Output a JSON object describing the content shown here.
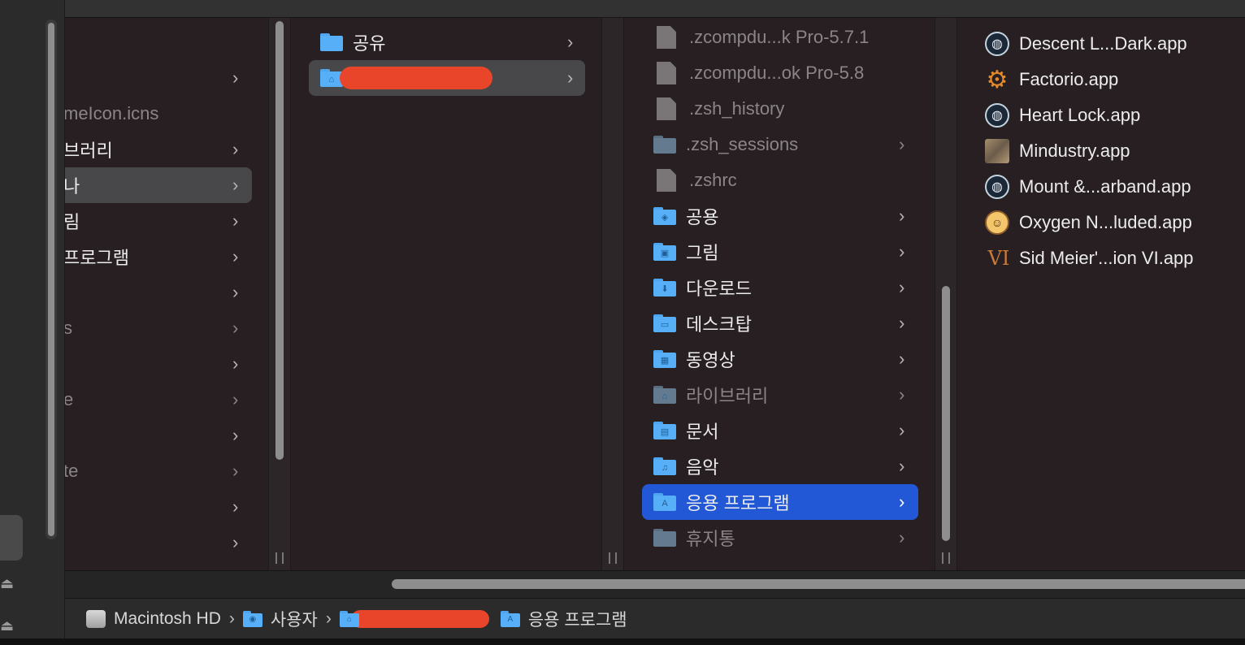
{
  "col1": {
    "items": [
      {
        "label": "",
        "chevron": true
      },
      {
        "label": "meIcon.icns",
        "chevron": false,
        "dim": true
      },
      {
        "label": "브러리",
        "chevron": true
      },
      {
        "label": "나",
        "chevron": true,
        "selected": true
      },
      {
        "label": "림",
        "chevron": true
      },
      {
        "label": "프로그램",
        "chevron": true
      },
      {
        "label": "",
        "chevron": true
      },
      {
        "label": "s",
        "chevron": true,
        "dim": true
      },
      {
        "label": "",
        "chevron": true
      },
      {
        "label": "e",
        "chevron": true,
        "dim": true
      },
      {
        "label": "",
        "chevron": true
      },
      {
        "label": "te",
        "chevron": true,
        "dim": true
      },
      {
        "label": "",
        "chevron": true
      },
      {
        "label": "",
        "chevron": true
      }
    ]
  },
  "col2": {
    "items": [
      {
        "label": "공유",
        "icon": "folder-icon",
        "chevron": true
      },
      {
        "label": "",
        "icon": "home-folder-icon",
        "chevron": true,
        "selected": true,
        "redacted": true
      }
    ]
  },
  "col3": {
    "items": [
      {
        "label": ".zcompdu...k Pro-5.7.1",
        "type": "file",
        "dim": true,
        "chevron": false
      },
      {
        "label": ".zcompdu...ok Pro-5.8",
        "type": "file",
        "dim": true,
        "chevron": false
      },
      {
        "label": ".zsh_history",
        "type": "file",
        "dim": true,
        "chevron": false
      },
      {
        "label": ".zsh_sessions",
        "type": "folder",
        "dim": true,
        "chevron": true
      },
      {
        "label": ".zshrc",
        "type": "file",
        "dim": true,
        "chevron": false
      },
      {
        "label": "공용",
        "type": "folder",
        "emblem": "◈",
        "chevron": true
      },
      {
        "label": "그림",
        "type": "folder",
        "emblem": "▣",
        "chevron": true
      },
      {
        "label": "다운로드",
        "type": "folder",
        "emblem": "⬇",
        "chevron": true
      },
      {
        "label": "데스크탑",
        "type": "folder",
        "emblem": "▭",
        "chevron": true
      },
      {
        "label": "동영상",
        "type": "folder",
        "emblem": "▦",
        "chevron": true
      },
      {
        "label": "라이브러리",
        "type": "folder",
        "emblem": "⌂",
        "dim": true,
        "chevron": true
      },
      {
        "label": "문서",
        "type": "folder",
        "emblem": "▤",
        "chevron": true
      },
      {
        "label": "음악",
        "type": "folder",
        "emblem": "♫",
        "chevron": true
      },
      {
        "label": "응용 프로그램",
        "type": "folder",
        "emblem": "A",
        "chevron": true,
        "selected": true
      },
      {
        "label": "휴지통",
        "type": "folder",
        "dim": true,
        "chevron": true
      }
    ]
  },
  "col4": {
    "items": [
      {
        "label": "Descent L...Dark.app",
        "icon": "steam-icon"
      },
      {
        "label": "Factorio.app",
        "icon": "factorio-gear-icon"
      },
      {
        "label": "Heart Lock.app",
        "icon": "steam-icon"
      },
      {
        "label": "Mindustry.app",
        "icon": "mindustry-icon"
      },
      {
        "label": "Mount &...arband.app",
        "icon": "steam-icon"
      },
      {
        "label": "Oxygen N...luded.app",
        "icon": "oxygen-not-included-icon"
      },
      {
        "label": "Sid Meier'...ion VI.app",
        "icon": "civilization-vi-icon"
      }
    ]
  },
  "pathbar": {
    "crumbs": [
      {
        "label": "Macintosh HD",
        "icon": "disk-icon"
      },
      {
        "label": "사용자",
        "icon": "users-folder-icon"
      },
      {
        "label": "",
        "icon": "home-folder-icon",
        "redacted": true
      },
      {
        "label": "응용 프로그램",
        "icon": "applications-folder-icon"
      }
    ]
  },
  "colors": {
    "selection_active": "#2257d6",
    "selection_inactive": "#48484a",
    "folder_blue": "#57b0f7",
    "redaction": "#e8452a"
  }
}
